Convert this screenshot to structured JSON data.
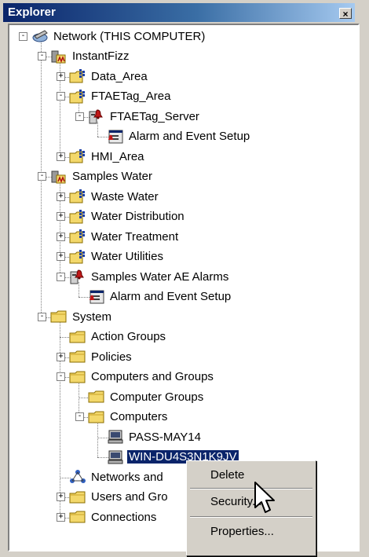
{
  "window": {
    "title": "Explorer",
    "close_glyph": "×"
  },
  "tree": [
    {
      "id": "network",
      "label": "Network (THIS COMPUTER)",
      "icon": "network-icon",
      "level": 0,
      "expander": "-"
    },
    {
      "id": "instantfizz",
      "label": "InstantFizz",
      "icon": "area-icon",
      "level": 1,
      "expander": "-"
    },
    {
      "id": "data-area",
      "label": "Data_Area",
      "icon": "server-folder-icon",
      "level": 2,
      "expander": "+"
    },
    {
      "id": "ftaetag-area",
      "label": "FTAETag_Area",
      "icon": "server-folder-icon",
      "level": 2,
      "expander": "-"
    },
    {
      "id": "ftaetag-server",
      "label": "FTAETag_Server",
      "icon": "alarm-server-icon",
      "level": 3,
      "expander": "-"
    },
    {
      "id": "alarm-setup-1",
      "label": "Alarm and Event Setup",
      "icon": "alarm-setup-icon",
      "level": 4,
      "expander": ""
    },
    {
      "id": "hmi-area",
      "label": "HMI_Area",
      "icon": "server-folder-icon",
      "level": 2,
      "expander": "+"
    },
    {
      "id": "samples-water",
      "label": "Samples Water",
      "icon": "area-icon",
      "level": 1,
      "expander": "-"
    },
    {
      "id": "waste-water",
      "label": "Waste Water",
      "icon": "server-folder-icon",
      "level": 2,
      "expander": "+"
    },
    {
      "id": "water-distribution",
      "label": "Water Distribution",
      "icon": "server-folder-icon",
      "level": 2,
      "expander": "+"
    },
    {
      "id": "water-treatment",
      "label": "Water Treatment",
      "icon": "server-folder-icon",
      "level": 2,
      "expander": "+"
    },
    {
      "id": "water-utilities",
      "label": "Water Utilities",
      "icon": "server-folder-icon",
      "level": 2,
      "expander": "+"
    },
    {
      "id": "samples-water-ae",
      "label": "Samples Water AE Alarms",
      "icon": "alarm-server-icon",
      "level": 2,
      "expander": "-"
    },
    {
      "id": "alarm-setup-2",
      "label": "Alarm and Event Setup",
      "icon": "alarm-setup-icon",
      "level": 3,
      "expander": ""
    },
    {
      "id": "system",
      "label": "System",
      "icon": "folder-icon",
      "level": 1,
      "expander": "-"
    },
    {
      "id": "action-groups",
      "label": "Action Groups",
      "icon": "folder-icon",
      "level": 2,
      "expander": ""
    },
    {
      "id": "policies",
      "label": "Policies",
      "icon": "folder-icon",
      "level": 2,
      "expander": "+"
    },
    {
      "id": "computers-and-groups",
      "label": "Computers and Groups",
      "icon": "folder-icon",
      "level": 2,
      "expander": "-"
    },
    {
      "id": "computer-groups",
      "label": "Computer Groups",
      "icon": "folder-icon",
      "level": 3,
      "expander": ""
    },
    {
      "id": "computers",
      "label": "Computers",
      "icon": "folder-icon",
      "level": 3,
      "expander": "-"
    },
    {
      "id": "pass-may14",
      "label": "PASS-MAY14",
      "icon": "computer-icon",
      "level": 4,
      "expander": ""
    },
    {
      "id": "win-du",
      "label": "WIN-DU4S3N1K9JV",
      "icon": "computer-icon",
      "level": 4,
      "expander": "",
      "selected": true
    },
    {
      "id": "networks-and",
      "label": "Networks and",
      "icon": "networks-icon",
      "level": 2,
      "expander": ""
    },
    {
      "id": "users-and-gro",
      "label": "Users and Gro",
      "icon": "folder-icon",
      "level": 2,
      "expander": "+"
    },
    {
      "id": "connections",
      "label": "Connections",
      "icon": "folder-icon",
      "level": 2,
      "expander": "+"
    }
  ],
  "context_menu": {
    "items": [
      "Delete",
      "Security...",
      "Properties..."
    ]
  },
  "colors": {
    "selection": "#0a246a",
    "folder": "#f0d060",
    "title_gradient_start": "#0a246a",
    "title_gradient_end": "#a6caf0"
  }
}
